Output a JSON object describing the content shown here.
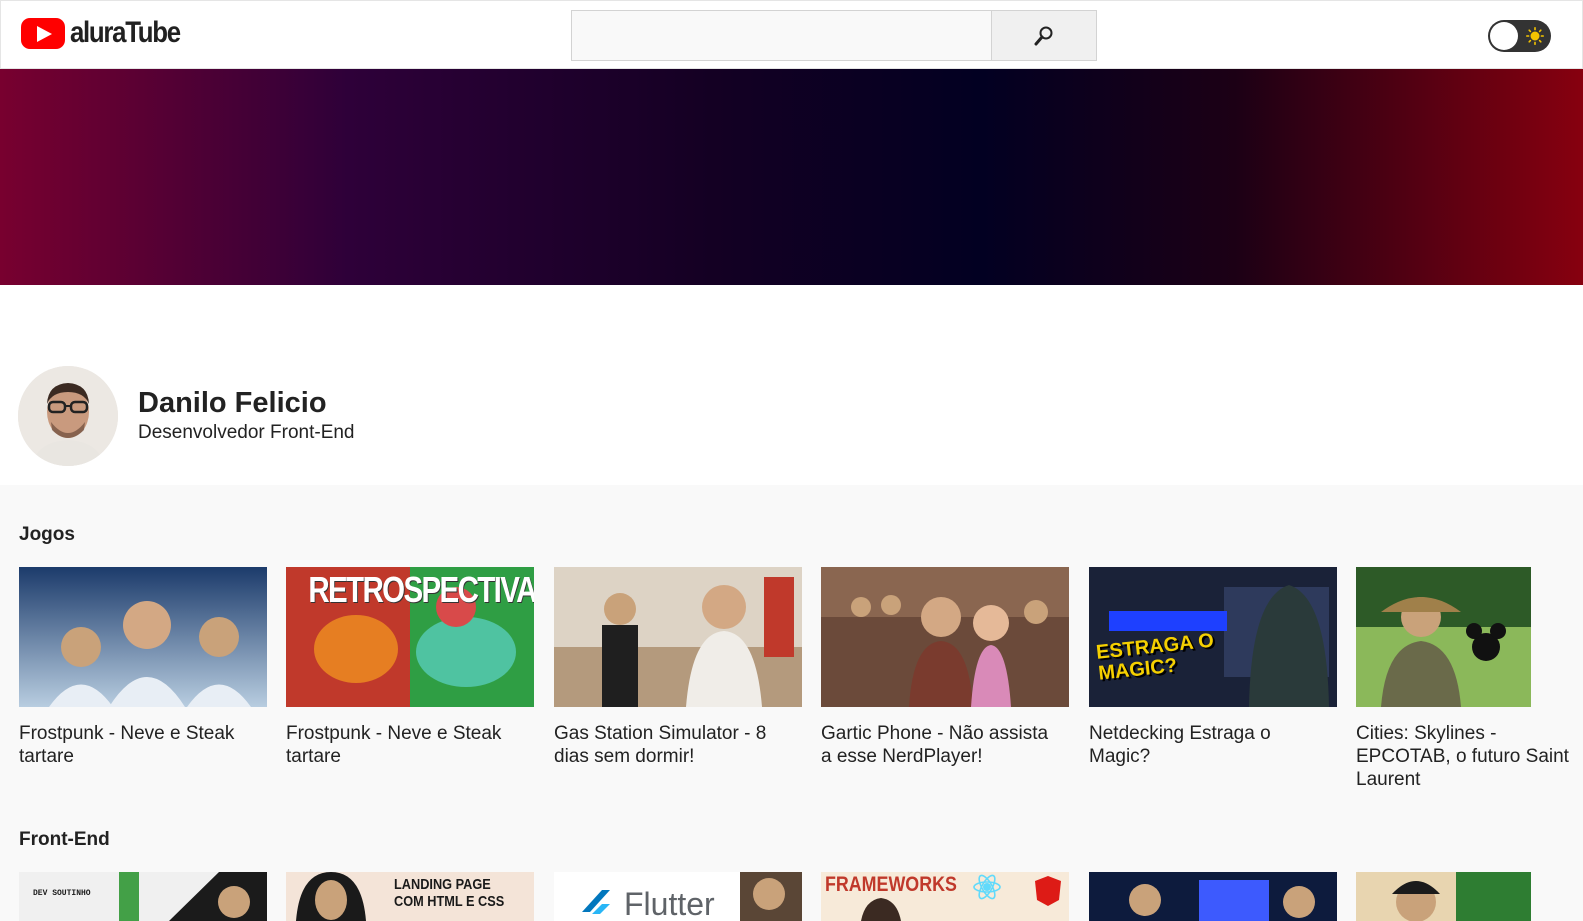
{
  "header": {
    "logo_text": "aluraTube",
    "search": {
      "value": "",
      "placeholder": ""
    },
    "search_icon": "magnifier-icon",
    "theme_toggle": {
      "state": "light",
      "icon": "sun-icon"
    }
  },
  "profile": {
    "name": "Danilo Felicio",
    "role": "Desenvolvedor Front-End"
  },
  "colors": {
    "brand_red": "#ff0000",
    "banner_gradient": [
      "#78002f",
      "#2e0039",
      "#020022",
      "#87000f"
    ]
  },
  "playlists": [
    {
      "title": "Jogos",
      "videos": [
        {
          "title": "Frostpunk - Neve e Steak tartare",
          "thumb": [
            "#1c3b6b",
            "#b8cde0"
          ]
        },
        {
          "title": "Frostpunk - Neve e Steak tartare",
          "thumb": [
            "#c0392b",
            "#2f9e44"
          ],
          "thumb_text": "RETROSPECTIVA"
        },
        {
          "title": "Gas Station Simulator - 8 dias sem dormir!",
          "thumb": [
            "#c8b8a0",
            "#7a6a58"
          ]
        },
        {
          "title": "Gartic Phone - Não assista a esse NerdPlayer!",
          "thumb": [
            "#6b4a3a",
            "#c9a27a"
          ]
        },
        {
          "title": "Netdecking Estraga o Magic?",
          "thumb": [
            "#1a2238",
            "#f5d000"
          ],
          "thumb_text": "ESTRAGA O MAGIC?"
        },
        {
          "title": "Cities: Skylines - EPCOTAB, o futuro Saint Laurent",
          "thumb": [
            "#2d5a27",
            "#8bb85a"
          ]
        }
      ]
    },
    {
      "title": "Front-End",
      "videos": [
        {
          "title": "",
          "thumb": [
            "#1b1b1b",
            "#f0f0f0"
          ],
          "thumb_text": "DEV SOUTINHO"
        },
        {
          "title": "",
          "thumb": [
            "#f4e4d8",
            "#1a1a1a"
          ],
          "thumb_text": "LANDING PAGE COM HTML E CSS"
        },
        {
          "title": "",
          "thumb": [
            "#ffffff",
            "#0277bd"
          ],
          "thumb_text": "Flutter"
        },
        {
          "title": "",
          "thumb": [
            "#f7ead9",
            "#c0392b"
          ],
          "thumb_text": "FRAMEWORKS"
        },
        {
          "title": "",
          "thumb": [
            "#0d1b3d",
            "#3d5afe"
          ]
        },
        {
          "title": "",
          "thumb": [
            "#e8d5b0",
            "#2e7d32"
          ]
        }
      ]
    }
  ]
}
